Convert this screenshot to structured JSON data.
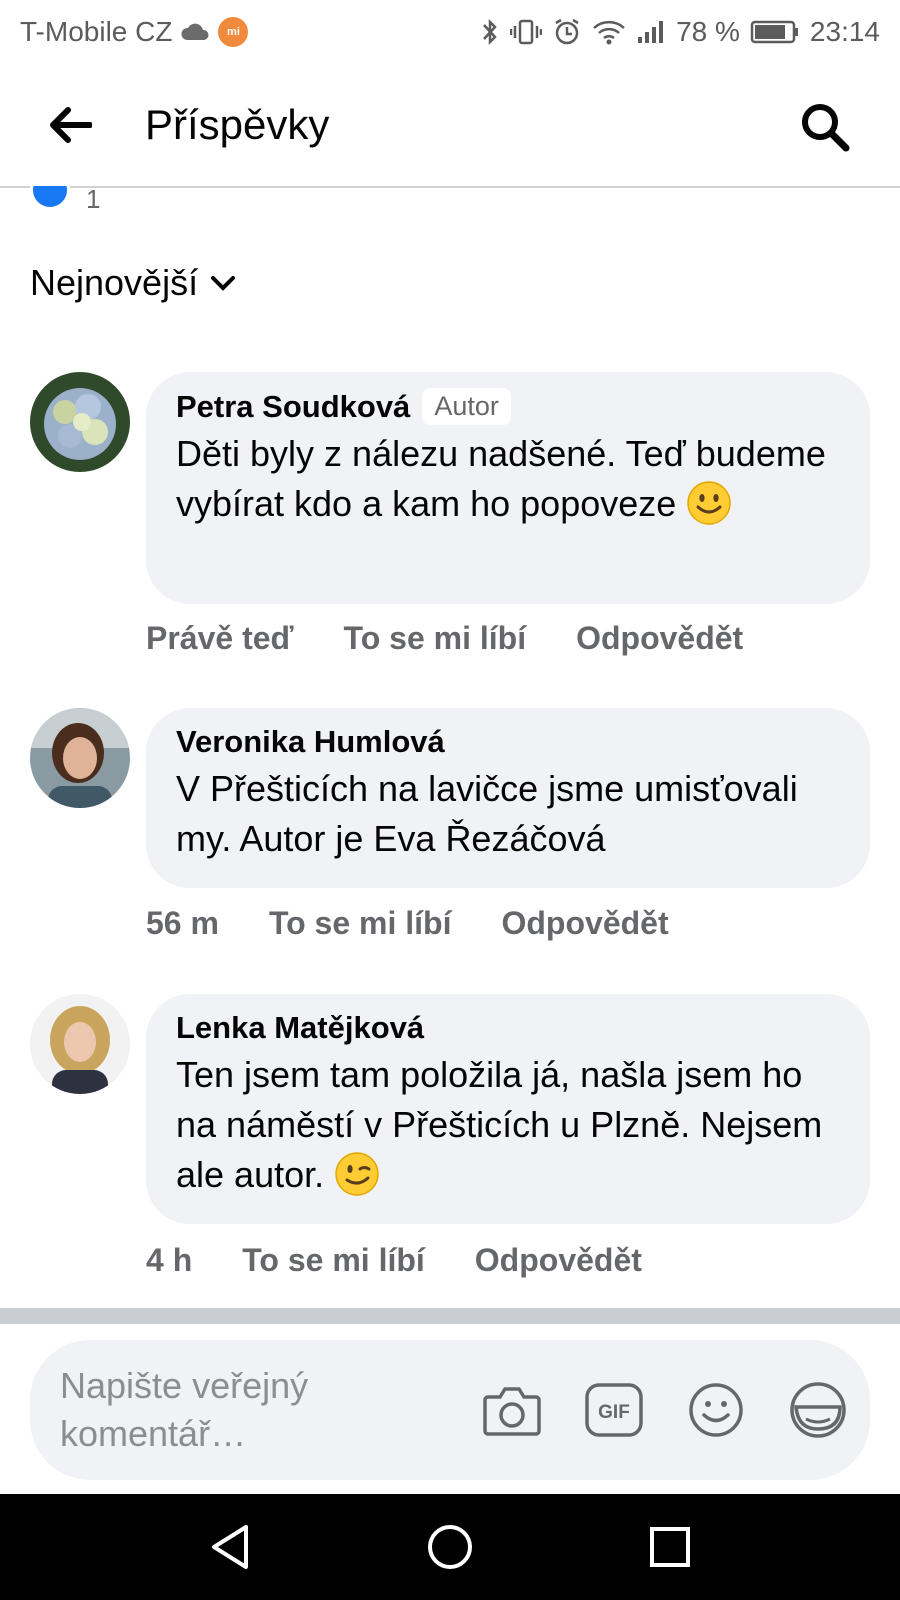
{
  "status_bar": {
    "carrier": "T-Mobile CZ",
    "mi_badge": "mi",
    "battery": "78 %",
    "time": "23:14"
  },
  "header": {
    "title": "Příspěvky",
    "back_icon": "arrow-left-icon",
    "search_icon": "search-icon"
  },
  "reaction_summary": {
    "count": "1",
    "color": "#1877f2"
  },
  "sort": {
    "label": "Nejnovější",
    "icon": "chevron-down-icon"
  },
  "comments": [
    {
      "author": "Petra Soudková",
      "badge": "Autor",
      "text": "Děti byly z nálezu nadšené. Teď budeme vybírat kdo a kam ho popoveze",
      "emoji": "slightly-smiling-face-icon",
      "time": "Právě teď",
      "like_label": "To se mi líbí",
      "reply_label": "Odpovědět"
    },
    {
      "author": "Veronika Humlová",
      "text": "V Přešticích na lavičce jsme umisťovali my. Autor je Eva Řezáčová",
      "time": "56 m",
      "like_label": "To se mi líbí",
      "reply_label": "Odpovědět"
    },
    {
      "author": "Lenka Matějková",
      "text": "Ten jsem tam položila já, našla jsem ho na náměstí v Přešticích u Plzně. Nejsem ale autor.",
      "emoji": "winking-face-icon",
      "time": "4 h",
      "like_label": "To se mi líbí",
      "reply_label": "Odpovědět"
    }
  ],
  "composer": {
    "placeholder": "Napište veřejný komentář…",
    "icons": [
      "camera-icon",
      "gif-icon",
      "emoji-icon",
      "sticker-icon"
    ]
  },
  "nav_bar": {
    "icons": [
      "nav-back-icon",
      "nav-home-icon",
      "nav-recents-icon"
    ]
  }
}
